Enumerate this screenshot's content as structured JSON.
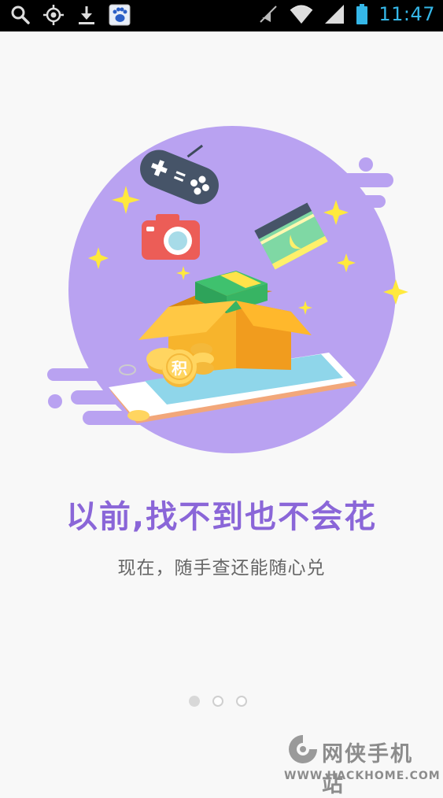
{
  "status_bar": {
    "time": "11:47",
    "icons": [
      "search-icon",
      "gps-icon",
      "download-icon",
      "baidu-app-icon",
      "mute-icon",
      "wifi-icon",
      "signal-icon",
      "battery-icon"
    ],
    "accent": "#35b7e8"
  },
  "onboarding": {
    "title": "以前,找不到也不会花",
    "subtitle": "现在，随手查还能随心兑",
    "illustration_coin_char": "积",
    "title_color": "#8a66d8",
    "blob_color": "#b9a2f1",
    "page_indicator": {
      "total": 3,
      "current": 1
    }
  },
  "watermark": {
    "brand": "网侠手机站",
    "url": "WWW.HACKHOME.COM"
  }
}
